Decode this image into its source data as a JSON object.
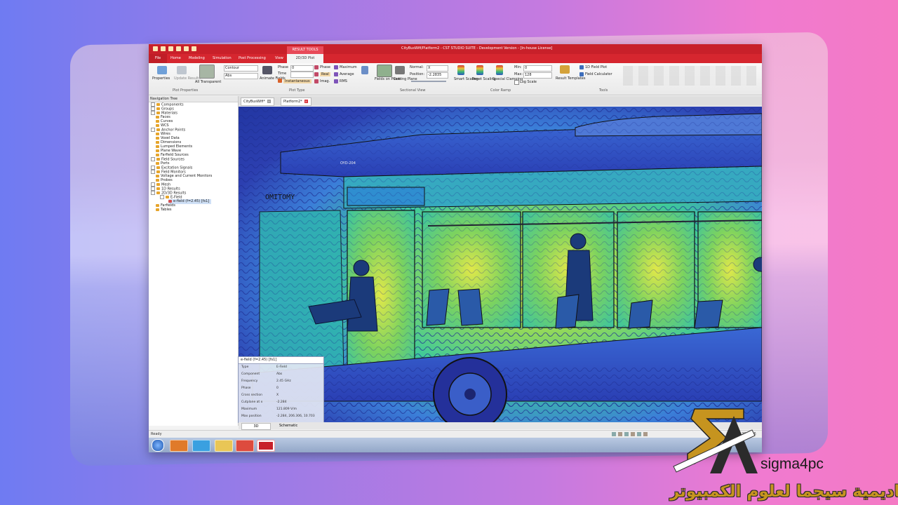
{
  "window": {
    "title": "CityBusWifi/Platform2 - CST STUDIO SUITE - Development Version - [In-house License]",
    "context_tab": "RESULT TOOLS",
    "context_subtab": "2D/3D Plot",
    "file_tab": "File",
    "tabs": [
      "Home",
      "Modeling",
      "Simulation",
      "Post Processing",
      "View"
    ]
  },
  "ribbon": {
    "properties": "Properties",
    "update_results": "Update Results",
    "all_transparent": "All Transparent",
    "plot_properties_group": "Plot Properties",
    "contour_select": "Contour",
    "abs_select": "Abs",
    "animate_fields": "Animate Fields",
    "phase_label": "Phase",
    "phase_value": "0",
    "time_label": "Time",
    "instantaneous": "Instantaneous",
    "phase_btn": "Phase",
    "real_btn": "Real",
    "imag_btn": "Imag.",
    "maximum_btn": "Maximum",
    "average_btn": "Average",
    "rms_btn": "RMS",
    "plot_type_group": "Plot Type",
    "fields_on_plane": "Fields on Plane",
    "cutting_plane": "Cutting Plane",
    "normal_label": "Normal:",
    "normal_value": "X",
    "position_label": "Position:",
    "position_value": "-2.2835",
    "sectional_view_group": "Sectional View",
    "smart_scaling": "Smart Scaling",
    "reset_scaling": "Reset Scaling",
    "special_clamping": "Special Clamping",
    "min_label": "Min:",
    "min_value": "0",
    "max_label": "Max:",
    "max_value": "128",
    "log_scale": "Log Scale",
    "color_ramp_group": "Color Ramp",
    "result_templates": "Result Templates",
    "field_plot_1d": "1D Field Plot",
    "field_calculator": "Field Calculator",
    "tools_group": "Tools"
  },
  "navigation": {
    "header": "Navigation Tree",
    "items": [
      "Components",
      "Groups",
      "Materials",
      "Faces",
      "Curves",
      "WCS",
      "Anchor Points",
      "Wires",
      "Voxel Data",
      "Dimensions",
      "Lumped Elements",
      "Plane Wave",
      "Farfield Sources",
      "Field Sources",
      "Ports",
      "Excitation Signals",
      "Field Monitors",
      "Voltage and Current Monitors",
      "Probes",
      "Mesh",
      "1D Results",
      "2D/3D Results",
      "E-Field",
      "e-field (f=2.45) [fs1]",
      "Farfields",
      "Tables"
    ]
  },
  "doc_tabs": [
    "CityBusWifi*",
    "Platform2*"
  ],
  "viewport": {
    "bus_sign": "OMITOMY",
    "bus_plate": "OYD-204"
  },
  "info": {
    "title": "e-field (f=2.45) [fs1]",
    "rows": [
      {
        "k": "Type",
        "v": "E-Field"
      },
      {
        "k": "Component",
        "v": "Abs"
      },
      {
        "k": "Frequency",
        "v": "2.45 GHz"
      },
      {
        "k": "Phase",
        "v": "0"
      },
      {
        "k": "Cross section",
        "v": "X"
      },
      {
        "k": "Cutplane at x",
        "v": "-2.284"
      },
      {
        "k": "Maximum",
        "v": "121.809 V/m"
      },
      {
        "k": "Max position",
        "v": "-2.284, 206.306, 10.703"
      }
    ]
  },
  "bottom_tabs": {
    "schematic": "Schematic",
    "tab1": "3D"
  },
  "status": {
    "ready": "Ready",
    "coords": "206.306"
  },
  "brand": {
    "name": "sigma4pc",
    "arabic": "اكاديمية سيجما لعلوم الكمبيوتر",
    "gold": "#c6941f"
  }
}
